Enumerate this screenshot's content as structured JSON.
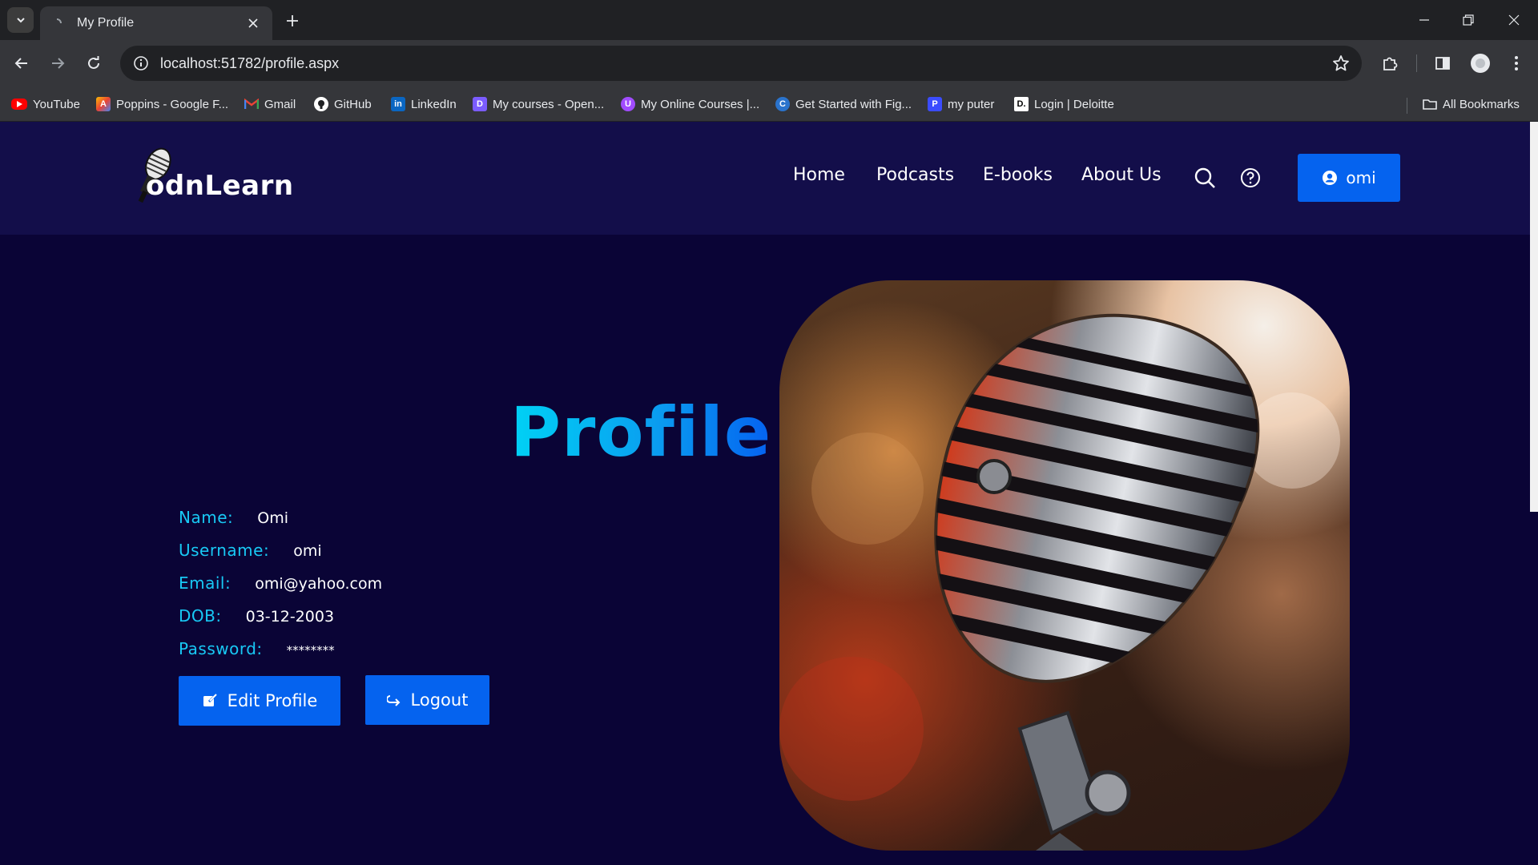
{
  "browser": {
    "tab_title": "My Profile",
    "url": "localhost:51782/profile.aspx",
    "bookmarks": [
      {
        "label": "YouTube",
        "icon": "youtube-icon",
        "color": "#ff0000"
      },
      {
        "label": "Poppins - Google F...",
        "icon": "google-fonts-icon",
        "color": "#fbbc04"
      },
      {
        "label": "Gmail",
        "icon": "gmail-icon",
        "color": "#ea4335"
      },
      {
        "label": "GitHub",
        "icon": "github-icon",
        "color": "#ffffff"
      },
      {
        "label": "LinkedIn",
        "icon": "linkedin-icon",
        "color": "#0a66c2"
      },
      {
        "label": "My courses - Open...",
        "icon": "course-icon",
        "color": "#7b5cff"
      },
      {
        "label": "My Online Courses |...",
        "icon": "online-courses-icon",
        "color": "#a14cff"
      },
      {
        "label": "Get Started with Fig...",
        "icon": "coursera-icon",
        "color": "#2a73cc"
      },
      {
        "label": "my puter",
        "icon": "puter-icon",
        "color": "#3b4cff"
      },
      {
        "label": "Login | Deloitte",
        "icon": "deloitte-icon",
        "color": "#ffffff"
      }
    ],
    "all_bookmarks": "All Bookmarks"
  },
  "site": {
    "logo_text": "odnLearn",
    "nav": {
      "home": "Home",
      "podcasts": "Podcasts",
      "ebooks": "E-books",
      "about": "About Us"
    },
    "user_button": "omi"
  },
  "profile": {
    "title": "Profile",
    "fields": {
      "name_label": "Name:",
      "name_value": "Omi",
      "username_label": "Username:",
      "username_value": "omi",
      "email_label": "Email:",
      "email_value": "omi@yahoo.com",
      "dob_label": "DOB:",
      "dob_value": "03-12-2003",
      "password_label": "Password:",
      "password_value": "********"
    },
    "edit_button": "Edit Profile",
    "logout_button": "Logout"
  },
  "colors": {
    "page_bg": "#0a0436",
    "header_bg": "#130e4a",
    "accent_blue": "#0563ef",
    "label_cyan": "#18c9f5"
  }
}
